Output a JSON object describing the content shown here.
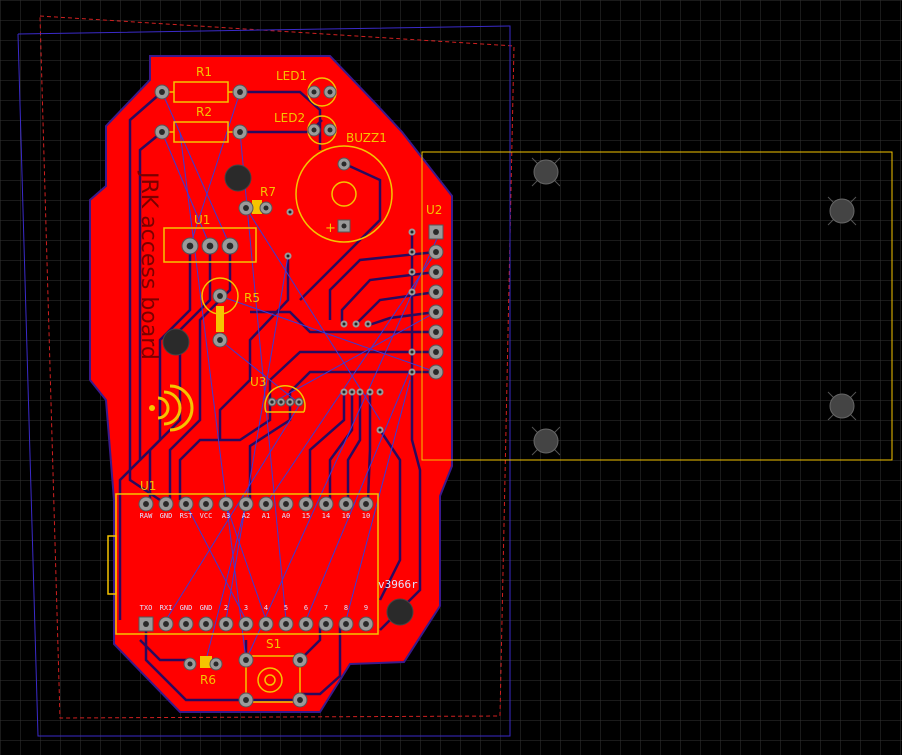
{
  "editor": {
    "background_color": "#000000",
    "grid_color": "#2e2e2e",
    "board_color": "#ff0000",
    "board_outline_color": "#3a1a8c",
    "silkscreen_color": "#f5c400",
    "ratsnest_color": "#3b3bd6",
    "pad_color": "#9a9a9a",
    "keepout_color": "#d02020"
  },
  "board": {
    "title_text": "JRK access board",
    "revision_text": "v3966r",
    "logo_name": "wireless-signal-icon"
  },
  "components": {
    "R1": "R1",
    "R2": "R2",
    "R5": "R5",
    "R6": "R6",
    "R7": "R7",
    "LED1": "LED1",
    "LED2": "LED2",
    "BUZZ1": "BUZZ1",
    "U1_reg": "U1",
    "U1_mcu": "U1",
    "U2": "U2",
    "U3": "U3",
    "S1": "S1",
    "buzzer_polarity": "+"
  },
  "mcu_top_pins": [
    "RAW",
    "GND",
    "RST",
    "VCC",
    "A3",
    "A2",
    "A1",
    "A0",
    "15",
    "14",
    "16",
    "10"
  ],
  "mcu_bottom_pins": [
    "TXO",
    "RXI",
    "GND",
    "GND",
    "2",
    "3",
    "4",
    "5",
    "6",
    "7",
    "8",
    "9"
  ]
}
